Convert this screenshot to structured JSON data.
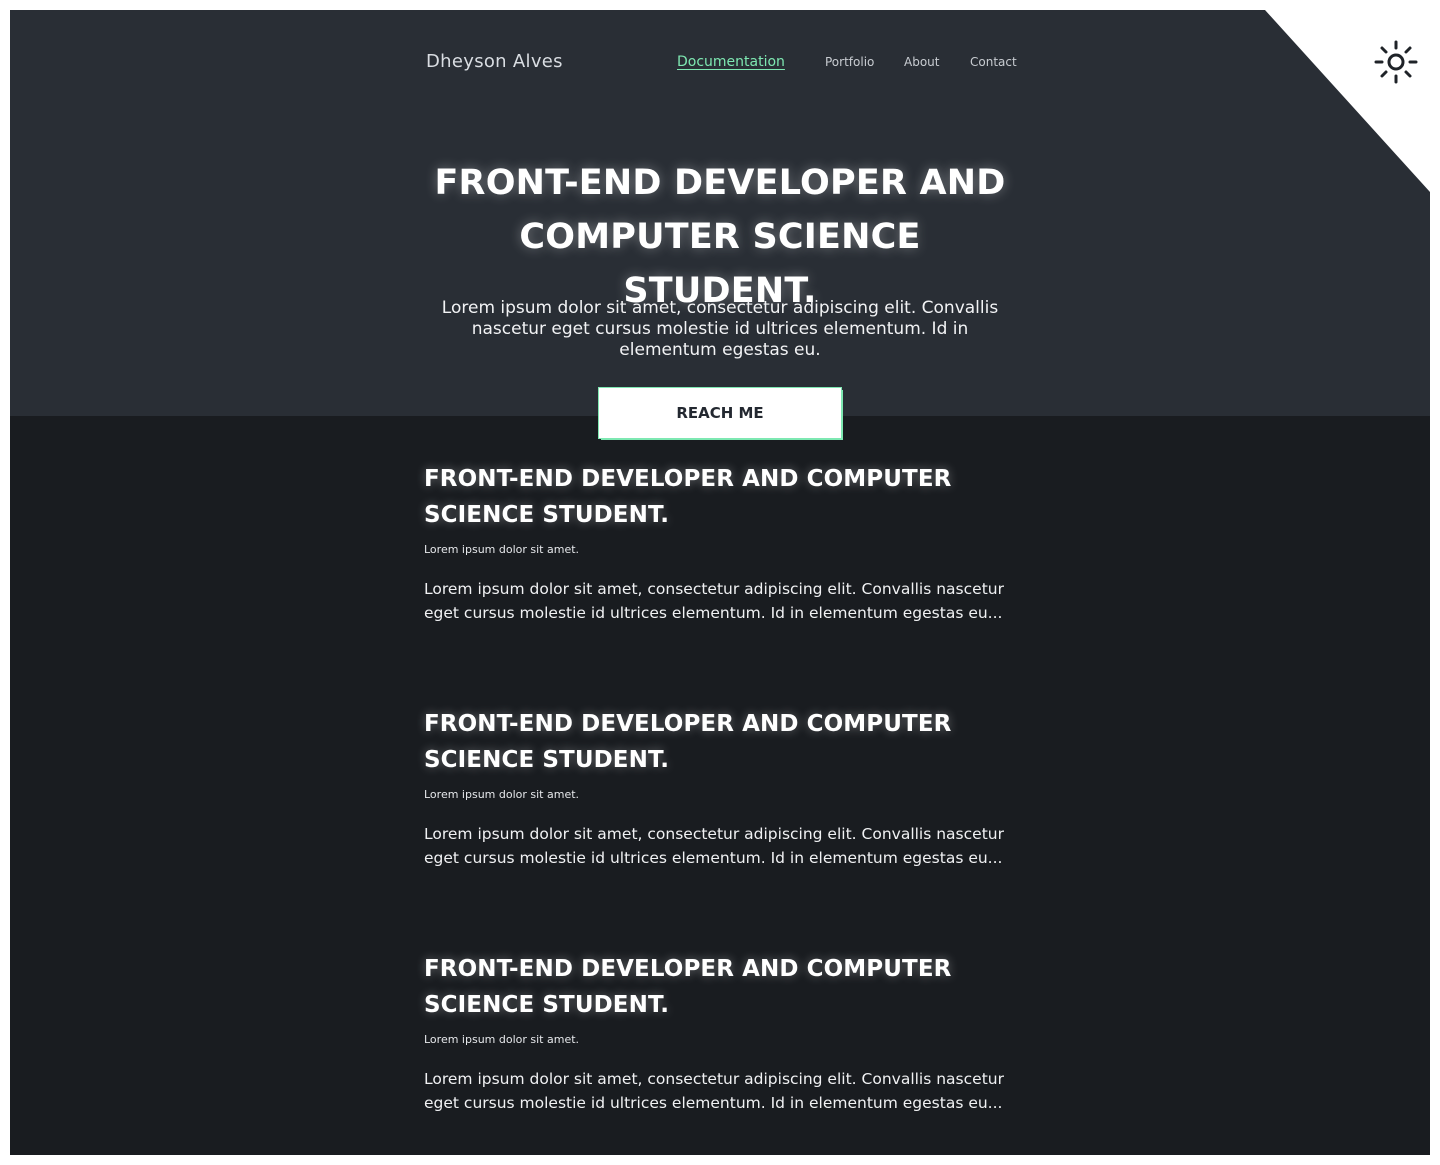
{
  "header": {
    "brand": "Dheyson Alves",
    "nav": [
      {
        "label": "Documentation",
        "active": true
      },
      {
        "label": "Portfolio",
        "active": false
      },
      {
        "label": "About",
        "active": false
      },
      {
        "label": "Contact",
        "active": false
      }
    ],
    "theme_icon": "sun-icon"
  },
  "hero": {
    "title": "FRONT-END DEVELOPER AND COMPUTER SCIENCE STUDENT.",
    "description": "Lorem ipsum dolor sit amet, consectetur adipiscing elit. Convallis nascetur eget cursus molestie id ultrices elementum. Id in elementum egestas eu.",
    "button_label": "REACH ME"
  },
  "articles": [
    {
      "title": "FRONT-END DEVELOPER AND COMPUTER SCIENCE STUDENT.",
      "subtitle": "Lorem ipsum dolor sit amet.",
      "body": "Lorem ipsum dolor sit amet, consectetur adipiscing elit. Convallis nascetur eget cursus molestie id ultrices elementum. Id in elementum egestas eu..."
    },
    {
      "title": "FRONT-END DEVELOPER AND COMPUTER SCIENCE STUDENT.",
      "subtitle": "Lorem ipsum dolor sit amet.",
      "body": "Lorem ipsum dolor sit amet, consectetur adipiscing elit. Convallis nascetur eget cursus molestie id ultrices elementum. Id in elementum egestas eu..."
    },
    {
      "title": "FRONT-END DEVELOPER AND COMPUTER SCIENCE STUDENT.",
      "subtitle": "Lorem ipsum dolor sit amet.",
      "body": "Lorem ipsum dolor sit amet, consectetur adipiscing elit. Convallis nascetur eget cursus molestie id ultrices elementum. Id in elementum egestas eu..."
    }
  ],
  "colors": {
    "hero_bg": "#292e35",
    "page_bg": "#191c20",
    "accent": "#7ee8b2",
    "text": "#ffffff"
  }
}
